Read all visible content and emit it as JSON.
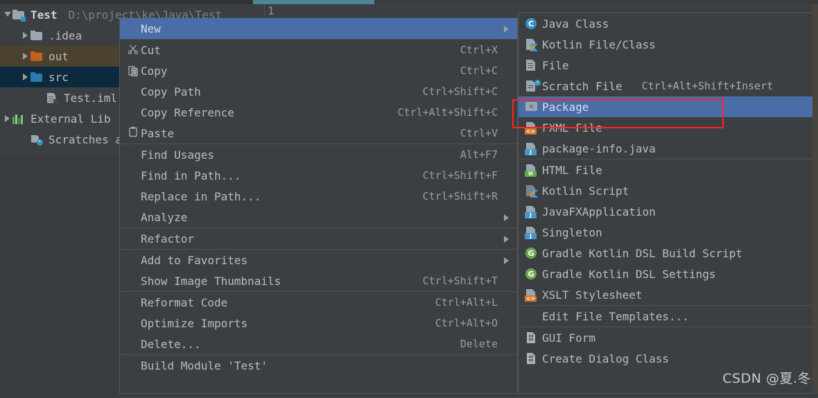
{
  "window": {
    "theme_bg": "#3c3f41",
    "accent_selection": "#4a6da7",
    "annotation_color": "#ff2222"
  },
  "tab_bar": {
    "active_tab_indicator": "active-tab-underline",
    "partial_tab_label": "1"
  },
  "project_tree": {
    "rows": [
      {
        "label": "Test",
        "path": "D:\\project\\ke\\Java\\Test",
        "icon": "module-folder-icon",
        "arrow": "expanded",
        "indent": 4,
        "bold": true,
        "state": "normal"
      },
      {
        "label": ".idea",
        "path": "",
        "icon": "folder-icon",
        "arrow": "collapsed",
        "indent": 30,
        "bold": false,
        "state": "normal"
      },
      {
        "label": "out",
        "path": "",
        "icon": "folder-orange-icon",
        "arrow": "collapsed",
        "indent": 30,
        "bold": false,
        "state": "hover"
      },
      {
        "label": "src",
        "path": "",
        "icon": "folder-blue-icon",
        "arrow": "collapsed",
        "indent": 30,
        "bold": false,
        "state": "selected"
      },
      {
        "label": "Test.iml",
        "path": "",
        "icon": "iml-file-icon",
        "arrow": "none",
        "indent": 52,
        "bold": false,
        "state": "normal"
      },
      {
        "label": "External Lib",
        "path": "",
        "icon": "libraries-icon",
        "arrow": "collapsed",
        "indent": 4,
        "bold": false,
        "state": "normal"
      },
      {
        "label": "Scratches a",
        "path": "",
        "icon": "scratches-icon",
        "arrow": "none",
        "indent": 30,
        "bold": false,
        "state": "normal"
      }
    ]
  },
  "context_menu": {
    "items": [
      {
        "label": "New",
        "shortcut": "",
        "icon": "",
        "submenu": true,
        "selected": true,
        "sep_after": true
      },
      {
        "label": "Cut",
        "shortcut": "Ctrl+X",
        "icon": "scissors-icon",
        "submenu": false,
        "selected": false,
        "sep_after": false
      },
      {
        "label": "Copy",
        "shortcut": "Ctrl+C",
        "icon": "copy-icon",
        "submenu": false,
        "selected": false,
        "sep_after": false
      },
      {
        "label": "Copy Path",
        "shortcut": "Ctrl+Shift+C",
        "icon": "",
        "submenu": false,
        "selected": false,
        "sep_after": false
      },
      {
        "label": "Copy Reference",
        "shortcut": "Ctrl+Alt+Shift+C",
        "icon": "",
        "submenu": false,
        "selected": false,
        "sep_after": false
      },
      {
        "label": "Paste",
        "shortcut": "Ctrl+V",
        "icon": "paste-icon",
        "submenu": false,
        "selected": false,
        "sep_after": true
      },
      {
        "label": "Find Usages",
        "shortcut": "Alt+F7",
        "icon": "",
        "submenu": false,
        "selected": false,
        "sep_after": false
      },
      {
        "label": "Find in Path...",
        "shortcut": "Ctrl+Shift+F",
        "icon": "",
        "submenu": false,
        "selected": false,
        "sep_after": false
      },
      {
        "label": "Replace in Path...",
        "shortcut": "Ctrl+Shift+R",
        "icon": "",
        "submenu": false,
        "selected": false,
        "sep_after": false
      },
      {
        "label": "Analyze",
        "shortcut": "",
        "icon": "",
        "submenu": true,
        "selected": false,
        "sep_after": true
      },
      {
        "label": "Refactor",
        "shortcut": "",
        "icon": "",
        "submenu": true,
        "selected": false,
        "sep_after": true
      },
      {
        "label": "Add to Favorites",
        "shortcut": "",
        "icon": "",
        "submenu": true,
        "selected": false,
        "sep_after": false
      },
      {
        "label": "Show Image Thumbnails",
        "shortcut": "Ctrl+Shift+T",
        "icon": "",
        "submenu": false,
        "selected": false,
        "sep_after": true
      },
      {
        "label": "Reformat Code",
        "shortcut": "Ctrl+Alt+L",
        "icon": "",
        "submenu": false,
        "selected": false,
        "sep_after": false
      },
      {
        "label": "Optimize Imports",
        "shortcut": "Ctrl+Alt+O",
        "icon": "",
        "submenu": false,
        "selected": false,
        "sep_after": false
      },
      {
        "label": "Delete...",
        "shortcut": "Delete",
        "icon": "",
        "submenu": false,
        "selected": false,
        "sep_after": true
      },
      {
        "label": "Build Module 'Test'",
        "shortcut": "",
        "icon": "",
        "submenu": false,
        "selected": false,
        "sep_after": false
      }
    ]
  },
  "submenu": {
    "items": [
      {
        "label": "Java Class",
        "shortcut": "",
        "icon": "java-class-icon",
        "selected": false,
        "sep_after": false
      },
      {
        "label": "Kotlin File/Class",
        "shortcut": "",
        "icon": "kotlin-file-icon",
        "selected": false,
        "sep_after": false
      },
      {
        "label": "File",
        "shortcut": "",
        "icon": "file-icon",
        "selected": false,
        "sep_after": false
      },
      {
        "label": "Scratch File",
        "shortcut": "Ctrl+Alt+Shift+Insert",
        "icon": "scratch-file-icon",
        "selected": false,
        "sep_after": false
      },
      {
        "label": "Package",
        "shortcut": "",
        "icon": "package-icon",
        "selected": true,
        "sep_after": false
      },
      {
        "label": "FXML File",
        "shortcut": "",
        "icon": "fxml-file-icon",
        "selected": false,
        "sep_after": false
      },
      {
        "label": "package-info.java",
        "shortcut": "",
        "icon": "java-file-icon",
        "selected": false,
        "sep_after": true
      },
      {
        "label": "HTML File",
        "shortcut": "",
        "icon": "html-file-icon",
        "selected": false,
        "sep_after": false
      },
      {
        "label": "Kotlin Script",
        "shortcut": "",
        "icon": "kotlin-script-icon",
        "selected": false,
        "sep_after": false
      },
      {
        "label": "JavaFXApplication",
        "shortcut": "",
        "icon": "java-file-icon",
        "selected": false,
        "sep_after": false
      },
      {
        "label": "Singleton",
        "shortcut": "",
        "icon": "java-file-icon",
        "selected": false,
        "sep_after": false
      },
      {
        "label": "Gradle Kotlin DSL Build Script",
        "shortcut": "",
        "icon": "gradle-icon",
        "selected": false,
        "sep_after": false
      },
      {
        "label": "Gradle Kotlin DSL Settings",
        "shortcut": "",
        "icon": "gradle-icon",
        "selected": false,
        "sep_after": false
      },
      {
        "label": "XSLT Stylesheet",
        "shortcut": "",
        "icon": "xslt-file-icon",
        "selected": false,
        "sep_after": true
      },
      {
        "label": "Edit File Templates...",
        "shortcut": "",
        "icon": "",
        "selected": false,
        "sep_after": true
      },
      {
        "label": "GUI Form",
        "shortcut": "",
        "icon": "gui-form-icon",
        "selected": false,
        "sep_after": false
      },
      {
        "label": "Create Dialog Class",
        "shortcut": "",
        "icon": "gui-form-icon",
        "selected": false,
        "sep_after": false
      }
    ]
  },
  "watermark": {
    "text": "CSDN @夏.冬"
  }
}
